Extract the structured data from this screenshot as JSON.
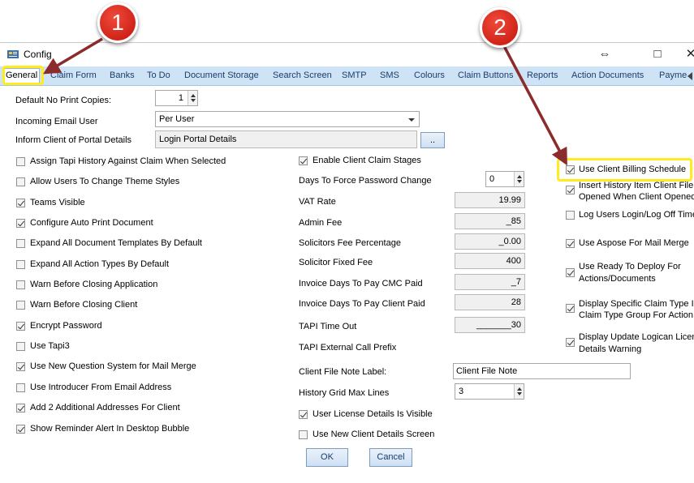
{
  "window": {
    "title": "Config",
    "controls": {
      "resize": "⇔",
      "maximize": "□",
      "close": "✕"
    }
  },
  "tabs": [
    "General",
    "Claim Form",
    "Banks",
    "To Do",
    "Document Storage",
    "Search Screen",
    "SMTP",
    "SMS",
    "Colours",
    "Claim Buttons",
    "Reports",
    "Action Documents",
    "Payme"
  ],
  "fields": {
    "default_no_print_copies": {
      "label": "Default No Print Copies:",
      "value": "1"
    },
    "incoming_email_user": {
      "label": "Incoming Email User",
      "value": "Per User"
    },
    "inform_client": {
      "label": "Inform Client of Portal Details",
      "value": "Login Portal Details",
      "button": ".."
    }
  },
  "left_checkboxes": [
    {
      "label": "Assign Tapi History Against Claim When Selected",
      "checked": false
    },
    {
      "label": "Allow Users To Change Theme Styles",
      "checked": false
    },
    {
      "label": "Teams Visible",
      "checked": true
    },
    {
      "label": "Configure Auto Print Document",
      "checked": true
    },
    {
      "label": "Expand All Document Templates By Default",
      "checked": false
    },
    {
      "label": "Expand All Action Types By Default",
      "checked": false
    },
    {
      "label": "Warn Before Closing Application",
      "checked": false
    },
    {
      "label": "Warn Before Closing Client",
      "checked": false
    },
    {
      "label": "Encrypt Password",
      "checked": true
    },
    {
      "label": "Use Tapi3",
      "checked": false
    },
    {
      "label": "Use New Question System for Mail Merge",
      "checked": true
    },
    {
      "label": "Use Introducer From Email Address",
      "checked": false
    },
    {
      "label": "Add 2 Additional Addresses For Client",
      "checked": true
    },
    {
      "label": "Show Reminder Alert In Desktop Bubble",
      "checked": true
    }
  ],
  "middle": {
    "enable_client_claim_stages": {
      "label": "Enable Client Claim Stages",
      "checked": true
    },
    "days_force_password_change": {
      "label": "Days To Force Password Change",
      "value": "0"
    },
    "vat_rate": {
      "label": "VAT Rate",
      "value": "19.99"
    },
    "admin_fee": {
      "label": "Admin Fee",
      "value": "_85"
    },
    "solicitors_fee_percentage": {
      "label": "Solicitors Fee Percentage",
      "value": "_0.00"
    },
    "solicitor_fixed_fee": {
      "label": "Solicitor Fixed Fee",
      "value": "400"
    },
    "invoice_days_cmc": {
      "label": "Invoice Days To Pay CMC Paid",
      "value": "_7"
    },
    "invoice_days_client": {
      "label": "Invoice Days To Pay Client Paid",
      "value": "28"
    },
    "tapi_time_out": {
      "label": "TAPI Time Out",
      "value": "_______30"
    },
    "tapi_external_call_prefix": {
      "label": "TAPI External Call Prefix"
    },
    "client_file_note_label": {
      "label": "Client File Note Label:",
      "value": "Client File Note"
    },
    "history_grid_max_lines": {
      "label": "History Grid Max Lines",
      "value": "3"
    },
    "user_license_details_visible": {
      "label": "User License Details Is Visible",
      "checked": true
    },
    "use_new_client_details_screen": {
      "label": "Use New Client Details Screen",
      "checked": false
    }
  },
  "right_checkboxes": [
    {
      "line1": "Use Client Billing Schedule",
      "line2": "",
      "checked": true
    },
    {
      "line1": "Insert History Item Client File",
      "line2": "Opened When Client Opened",
      "checked": true
    },
    {
      "line1": "Log Users Login/Log Off Time",
      "line2": "",
      "checked": false
    },
    {
      "line1": "Use Aspose For Mail Merge",
      "line2": "",
      "checked": true
    },
    {
      "line1": "Use Ready To Deploy For",
      "line2": "Actions/Documents",
      "checked": true
    },
    {
      "line1": "Display Specific Claim Type In",
      "line2": "Claim Type Group For Action",
      "checked": true
    },
    {
      "line1": "Display Update Logican Licen",
      "line2": "Details Warning",
      "checked": true
    }
  ],
  "buttons": {
    "ok": "OK",
    "cancel": "Cancel"
  },
  "annotations": {
    "badge1": "1",
    "badge2": "2",
    "highlight_color": "#ffeb1e",
    "badge_color": "#d42a1f",
    "arrow_color": "#8b2b2b"
  },
  "background_texts": [
    "",
    "",
    ""
  ]
}
